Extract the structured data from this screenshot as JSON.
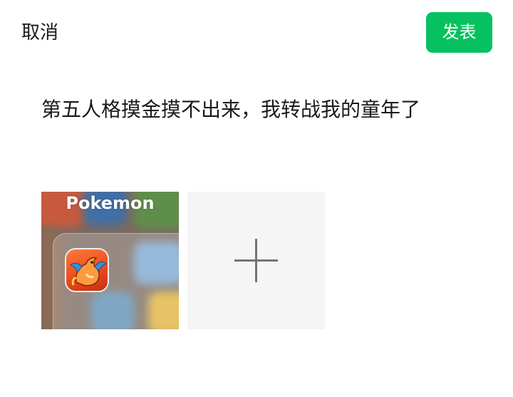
{
  "header": {
    "cancel_label": "取消",
    "publish_label": "发表",
    "publish_color": "#07c160"
  },
  "post": {
    "text": "第五人格摸金摸不出来，我转战我的童年了"
  },
  "attachments": {
    "image_caption": "Pokemon",
    "add_icon": "plus-icon"
  }
}
